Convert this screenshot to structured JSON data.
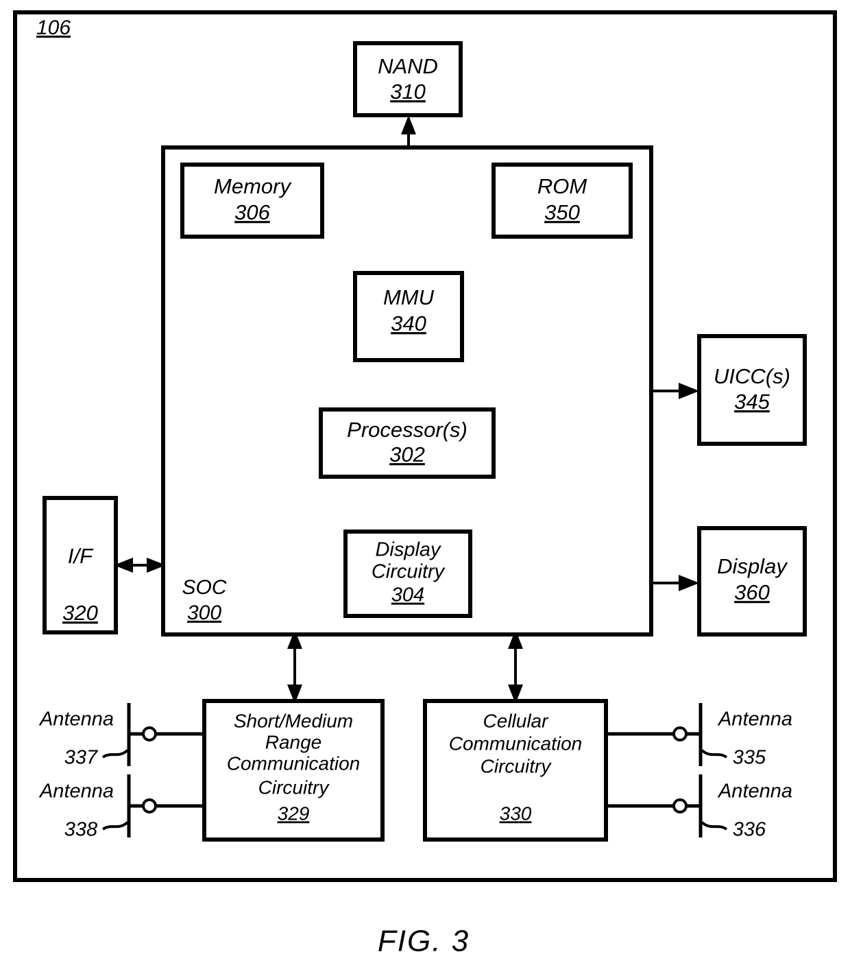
{
  "figure": {
    "caption": "FIG. 3",
    "outer_ref": "106"
  },
  "blocks": {
    "nand": {
      "title": "NAND",
      "ref": "310"
    },
    "memory": {
      "title": "Memory",
      "ref": "306"
    },
    "rom": {
      "title": "ROM",
      "ref": "350"
    },
    "mmu": {
      "title": "MMU",
      "ref": "340"
    },
    "processor": {
      "title": "Processor(s)",
      "ref": "302"
    },
    "display_circuitry": {
      "title_line1": "Display",
      "title_line2": "Circuitry",
      "ref": "304"
    },
    "soc": {
      "title": "SOC",
      "ref": "300"
    },
    "interface": {
      "title": "I/F",
      "ref": "320"
    },
    "uicc": {
      "title": "UICC(s)",
      "ref": "345"
    },
    "display": {
      "title": "Display",
      "ref": "360"
    },
    "short_medium_range": {
      "title_line1": "Short/Medium",
      "title_line2": "Range",
      "title_line3": "Communication",
      "title_line4": "Circuitry",
      "ref": "329"
    },
    "cellular": {
      "title_line1": "Cellular",
      "title_line2": "Communication",
      "title_line3": "Circuitry",
      "ref": "330"
    }
  },
  "antennas": [
    {
      "label": "Antenna",
      "ref": "337",
      "side": "left"
    },
    {
      "label": "Antenna",
      "ref": "338",
      "side": "left"
    },
    {
      "label": "Antenna",
      "ref": "335",
      "side": "right"
    },
    {
      "label": "Antenna",
      "ref": "336",
      "side": "right"
    }
  ],
  "colors": {
    "line": "#000000",
    "background": "#ffffff"
  }
}
